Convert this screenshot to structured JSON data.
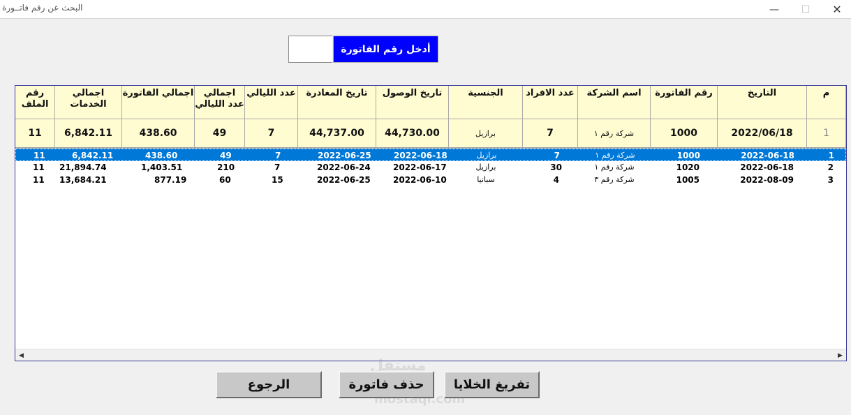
{
  "window": {
    "title": "البحث عن رقم فاتــورة",
    "min_glyph": "—",
    "max_glyph": "☐",
    "close_glyph": "✕"
  },
  "search": {
    "label": "أدخل رقم الفاتورة",
    "value": ""
  },
  "grid": {
    "headers": {
      "m": "م",
      "date": "التاريخ",
      "invoice_no": "رقم الفاتورة",
      "company": "اسم الشركة",
      "persons": "عدد الافراد",
      "nationality": "الجنسية",
      "arrival": "تاريخ الوصول",
      "departure": "تاريخ المغادرة",
      "nights": "عدد الليالي",
      "nights_total": "اجمالي عدد الليالي",
      "invoice_total": "اجمالي الفاتورة",
      "services_total": "اجمالي الخدمات",
      "file_no": "رقم الملف"
    },
    "filter": {
      "m": "1",
      "date": "2022/06/18",
      "invoice_no": "1000",
      "company": "شركة رقم ١",
      "persons": "7",
      "nationality": "برازيل",
      "arrival": "44,730.00",
      "departure": "44,737.00",
      "nights": "7",
      "nights_total": "49",
      "invoice_total": "438.60",
      "services_total": "6,842.11",
      "file_no": "11"
    },
    "rows": [
      {
        "m": "1",
        "date": "2022-06-18",
        "invoice_no": "1000",
        "company": "شركة رقم ١",
        "persons": "7",
        "nationality": "برازيل",
        "arrival": "2022-06-18",
        "departure": "2022-06-25",
        "nights": "7",
        "nights_total": "49",
        "invoice_total": "438.60",
        "services_total": "6,842.11",
        "file_no": "11"
      },
      {
        "m": "2",
        "date": "2022-06-18",
        "invoice_no": "1020",
        "company": "شركة رقم ١",
        "persons": "30",
        "nationality": "برازيل",
        "arrival": "2022-06-17",
        "departure": "2022-06-24",
        "nights": "7",
        "nights_total": "210",
        "invoice_total": "1,403.51",
        "services_total": "21,894.74",
        "file_no": "11"
      },
      {
        "m": "3",
        "date": "2022-08-09",
        "invoice_no": "1005",
        "company": "شركة رقم ٣",
        "persons": "4",
        "nationality": "سبانيا",
        "arrival": "2022-06-10",
        "departure": "2022-06-25",
        "nights": "15",
        "nights_total": "60",
        "invoice_total": "877.19",
        "services_total": "13,684.21",
        "file_no": "11"
      }
    ],
    "selected_row": 0,
    "scroll_left": "◀",
    "scroll_right": "▶"
  },
  "buttons": {
    "back": "الرجوع",
    "delete_invoice": "حذف فاتورة",
    "clear_cells": "تفريغ الخلايا"
  },
  "watermark": {
    "top": "مستقل",
    "bottom": "mostaql.com"
  },
  "colors": {
    "search_label_bg": "#0000ff",
    "header_bg": "#fffcd1",
    "selection": "#0078d7"
  }
}
